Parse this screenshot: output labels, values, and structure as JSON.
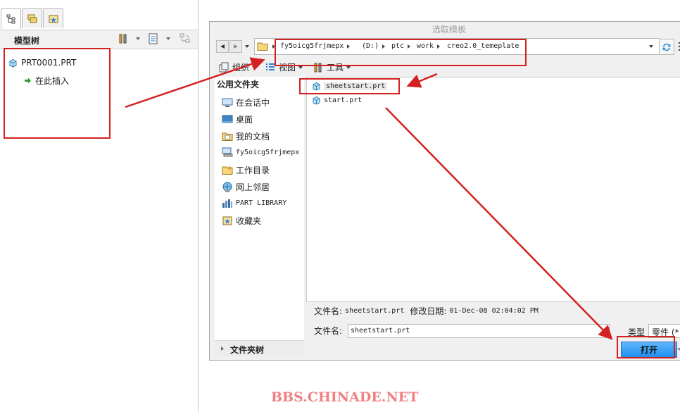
{
  "model_tree": {
    "title": "模型树",
    "root": "PRT0001.PRT",
    "insert_here": "在此插入"
  },
  "dialog": {
    "title": "选取模板",
    "path": [
      "fy5oicg5frjmepx",
      "(D:)",
      "ptc",
      "work",
      "creo2.0_temeplate"
    ],
    "toolbar": {
      "organize": "组织",
      "views": "视图",
      "tools": "工具"
    },
    "common_folders": {
      "title": "公用文件夹",
      "items": [
        "在会话中",
        "桌面",
        "我的文档",
        "fy5oicg5frjmepx",
        "工作目录",
        "网上邻居",
        "PART LIBRARY",
        "收藏夹"
      ]
    },
    "folder_tree": "文件夹树",
    "files": [
      "sheetstart.prt",
      "start.prt"
    ],
    "info": {
      "name_label": "文件名:",
      "name_value": "sheetstart.prt",
      "date_label": "修改日期:",
      "date_value": "01-Dec-08 02:04:02 PM"
    },
    "filename_label": "文件名:",
    "filename_value": "sheetstart.prt",
    "type_label": "类型",
    "type_value": "零件 (*",
    "open_label": "打开"
  },
  "watermark": "BBS.CHINADE.NET",
  "colors": {
    "annotation_red": "#d42020",
    "open_button": "#2f98f0"
  }
}
